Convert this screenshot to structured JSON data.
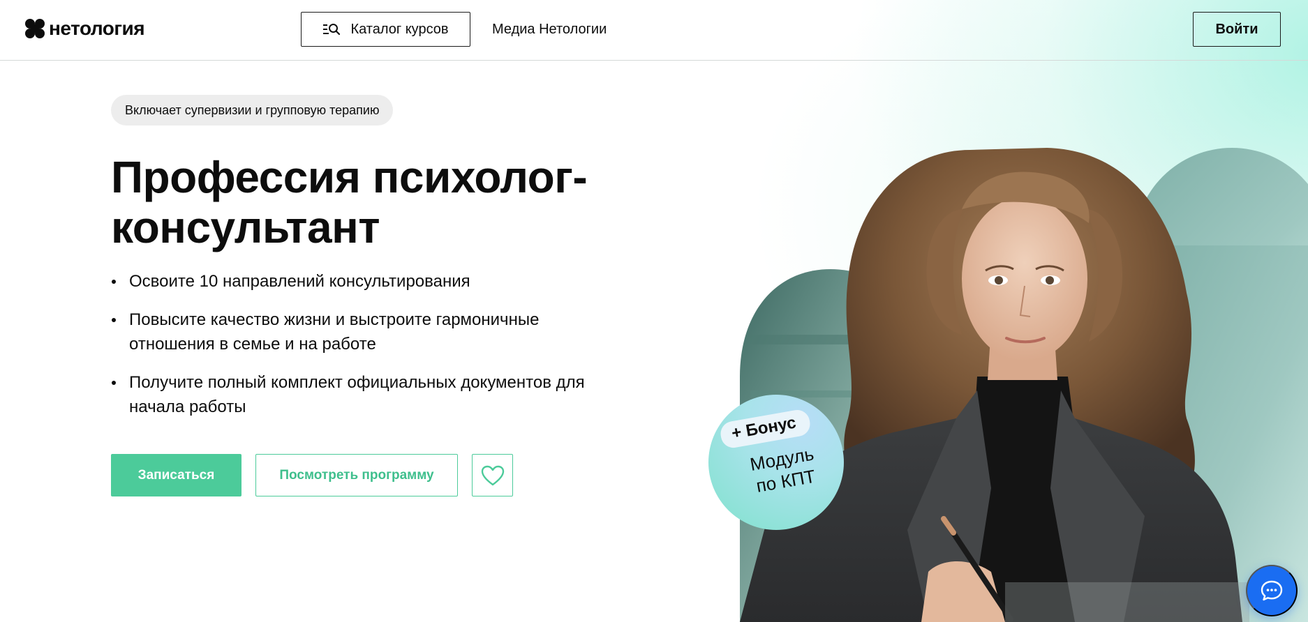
{
  "colors": {
    "accent": "#4ccb9a",
    "text": "#0d0d0d",
    "chat": "#1a6df2"
  },
  "header": {
    "logo_text": "нетология",
    "catalog_label": "Каталог курсов",
    "catalog_icon": "list-search-icon",
    "media_link": "Медиа Нетологии",
    "login_label": "Войти"
  },
  "hero": {
    "tag": "Включает супервизии и групповую терапию",
    "title": "Профессия психолог-консультант",
    "bullets": [
      "Освоите 10 направлений консультирования",
      "Повысите качество жизни и выстроите гармоничные отношения в семье и на работе",
      "Получите полный комплект официальных документов для начала работы"
    ],
    "primary_button": "Записаться",
    "secondary_button": "Посмотреть программу",
    "favorite_icon": "heart-icon"
  },
  "bonus": {
    "chip": "+ Бонус",
    "text": "Модуль по КПТ"
  },
  "chat": {
    "icon": "chat-bubble-icon"
  }
}
